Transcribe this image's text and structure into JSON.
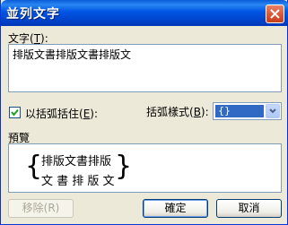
{
  "title": "並列文字",
  "text_label": "文字(",
  "text_label_key": "T",
  "text_label_end": "):",
  "text_value": "排版文書排版文書排版文",
  "checkbox_label": "以括弧括住(",
  "checkbox_key": "E",
  "checkbox_end": "):",
  "checkbox_checked": true,
  "bracket_label": "括弧樣式(",
  "bracket_key": "B",
  "bracket_end": "):",
  "bracket_value": "{}",
  "preview_label": "預覽",
  "preview": {
    "open": "{",
    "line1": "排版文書排版",
    "line2": "文 書 排 版 文",
    "close": "}"
  },
  "buttons": {
    "remove": "移除(R)",
    "ok": "確定",
    "cancel": "取消"
  }
}
